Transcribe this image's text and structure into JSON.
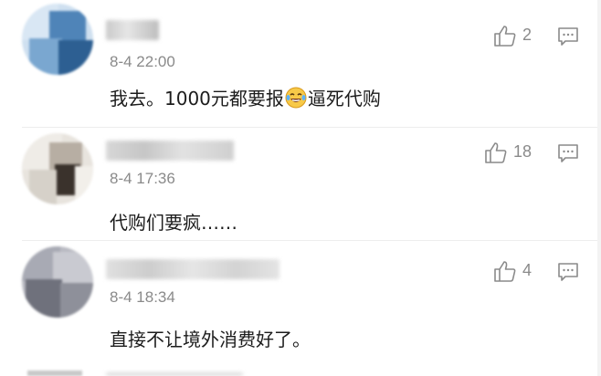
{
  "comments": [
    {
      "time": "8-4 22:00",
      "text_before": "我去。1000元都要报",
      "emoji_icon": "laughing-tears-emoji",
      "text_after": "逼死代购",
      "likes": "2"
    },
    {
      "time": "8-4 17:36",
      "text": "代购们要疯……",
      "likes": "18"
    },
    {
      "time": "8-4 18:34",
      "text": "直接不让境外消费好了。",
      "likes": "4"
    }
  ],
  "icons": {
    "like": "thumbs-up-icon",
    "reply": "reply-bubble-icon"
  },
  "colors": {
    "meta_gray": "#8a8a8a",
    "text": "#1c1c1c",
    "background": "#ffffff"
  }
}
